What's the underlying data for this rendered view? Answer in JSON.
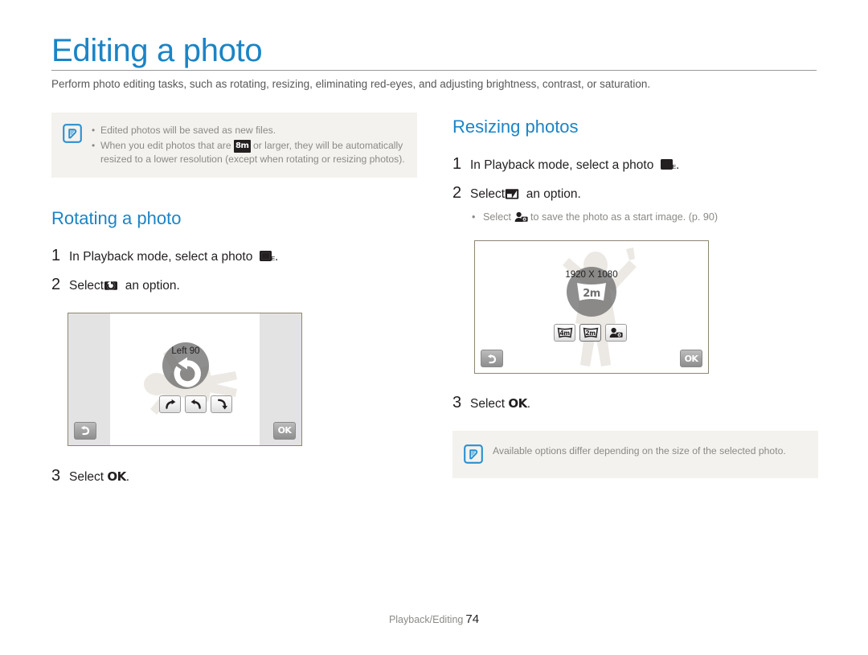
{
  "document": {
    "title": "Editing a photo",
    "intro": "Perform photo editing tasks, such as rotating, resizing, eliminating red-eyes, and adjusting brightness, contrast, or saturation.",
    "accent_color": "#1b84c6",
    "note_bg_color": "#f4f2ee",
    "body_color": "#231f20",
    "muted_color": "#8b8a86"
  },
  "top_note": {
    "icon": "note-pen-icon",
    "bullets": [
      {
        "pre": "Edited photos will be saved as new files.",
        "chip": "",
        "post": ""
      },
      {
        "pre": "When you edit photos that are ",
        "chip": "8m",
        "post": " or larger, they will be automatically resized to a lower resolution (except when rotating or resizing photos)."
      }
    ]
  },
  "rotating": {
    "heading": "Rotating a photo",
    "steps": [
      {
        "num": "1",
        "text_before": "In Playback mode, select a photo",
        "icon": "playback-mode-icon",
        "text_after": "."
      },
      {
        "num": "2",
        "text_before": "Select",
        "icon": "rotate-option-icon",
        "text_after": "an option."
      },
      {
        "num": "3",
        "text_before": "Select",
        "icon": "ok-glyph",
        "ok_label": "OK",
        "text_after": "."
      }
    ],
    "screen": {
      "badge_label": "Left 90",
      "center_icon": "rotate-left-large-icon",
      "buttons": [
        {
          "name": "rotate-right-90-button",
          "icon": "arrow-curve-right"
        },
        {
          "name": "rotate-left-90-button",
          "icon": "arrow-curve-left"
        },
        {
          "name": "flip-vertical-button",
          "icon": "arrow-curve-down"
        }
      ],
      "back_button": "back-arrow-icon",
      "ok_button": "OK"
    }
  },
  "resizing": {
    "heading": "Resizing photos",
    "steps": [
      {
        "num": "1",
        "text_before": "In Playback mode, select a photo",
        "icon": "playback-mode-icon",
        "text_after": "."
      },
      {
        "num": "2",
        "text_before": "Select",
        "icon": "resize-option-icon",
        "text_after": "an option."
      },
      {
        "num": "3",
        "text_before": "Select",
        "icon": "ok-glyph",
        "ok_label": "OK",
        "text_after": "."
      }
    ],
    "sub_bullet": {
      "before": "Select",
      "icon": "start-image-icon",
      "after": "to save the photo as a start image. (p. 90)"
    },
    "screen": {
      "badge_label": "1920 X 1080",
      "center_chip": "2m",
      "buttons": [
        {
          "name": "resize-4m-button",
          "label": "4m"
        },
        {
          "name": "resize-2m-button",
          "label": "2m"
        },
        {
          "name": "start-image-button",
          "label": ""
        }
      ],
      "back_button": "back-arrow-icon",
      "ok_button": "OK"
    },
    "note": {
      "icon": "note-pen-icon",
      "text": "Available options differ depending on the size of the selected photo."
    }
  },
  "footer": {
    "section": "Playback/Editing",
    "page_number": "74"
  }
}
